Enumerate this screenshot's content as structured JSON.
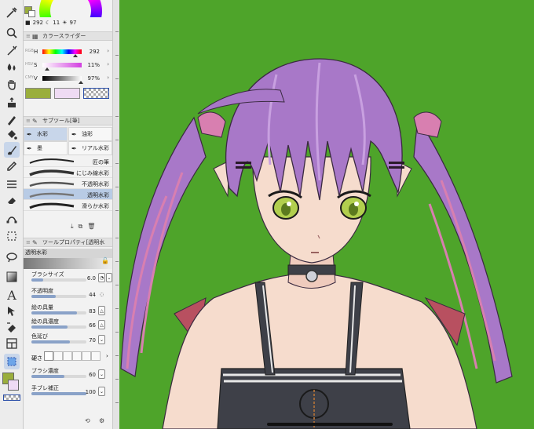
{
  "color_wheel": {
    "h": "292",
    "s": "11",
    "v": "97"
  },
  "color_slider": {
    "title": "カラースライダー",
    "side_labels": [
      "RGB",
      "HSV",
      "CMY"
    ],
    "rows": [
      {
        "label": "H",
        "value": "292"
      },
      {
        "label": "S",
        "value": "11%"
      },
      {
        "label": "V",
        "value": "97%"
      }
    ],
    "main_color": "#9aae3c",
    "sub_color": "#efdbf4"
  },
  "sub_tool": {
    "title": "サブツール[筆]",
    "tabs": [
      "水彩",
      "油彩",
      "墨",
      "リアル水彩"
    ],
    "brushes": [
      "匠の筆",
      "にじみ線水彩",
      "不透明水彩",
      "透明水彩",
      "滑らか水彩"
    ]
  },
  "tool_property": {
    "title": "ツールプロパティ[透明水",
    "brush_name": "透明水彩",
    "rows": [
      {
        "label": "ブラシサイズ",
        "value": "6.0"
      },
      {
        "label": "不透明度",
        "value": "44"
      },
      {
        "label": "絵の具量",
        "value": "83"
      },
      {
        "label": "絵の具濃度",
        "value": "66"
      },
      {
        "label": "色延び",
        "value": "70"
      }
    ],
    "hardness_label": "硬さ",
    "rows2": [
      {
        "label": "ブラシ濃度",
        "value": "60"
      },
      {
        "label": "手ブレ補正",
        "value": "100"
      }
    ]
  },
  "colors": {
    "canvas_bg": "#4ea42a",
    "hair": "#a878c8",
    "hair_pink": "#d87fb0",
    "skin": "#f6dccd",
    "dress": "#3e4048",
    "eye": "#b2cf4e"
  }
}
